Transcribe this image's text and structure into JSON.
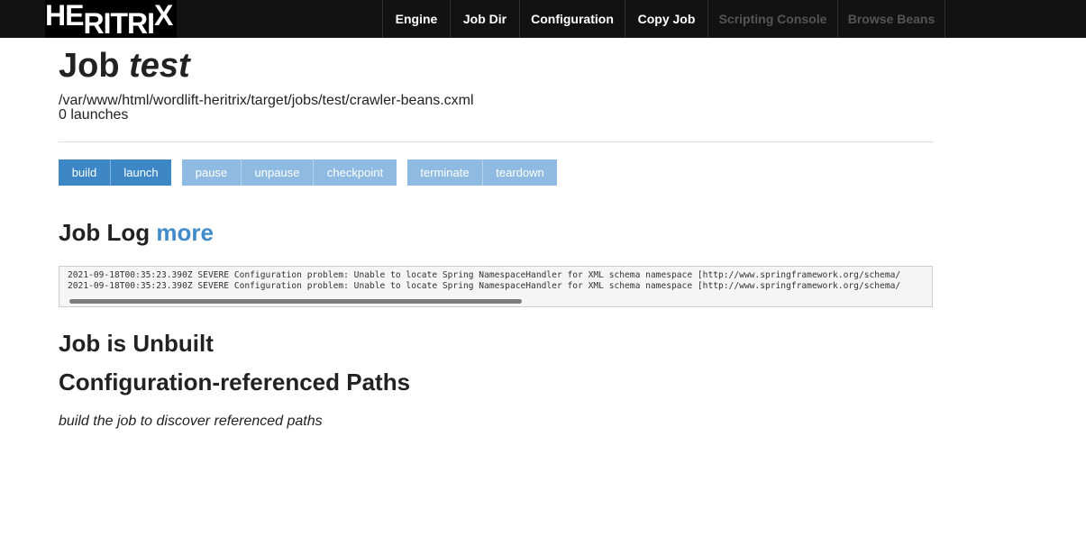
{
  "app": {
    "logo_parts": [
      "HE",
      "R",
      "I",
      "T",
      "R",
      "I",
      "X"
    ]
  },
  "nav": {
    "items": [
      {
        "label": "Engine",
        "enabled": true
      },
      {
        "label": "Job Dir",
        "enabled": true
      },
      {
        "label": "Configuration",
        "enabled": true
      },
      {
        "label": "Copy Job",
        "enabled": true
      },
      {
        "label": "Scripting Console",
        "enabled": false
      },
      {
        "label": "Browse Beans",
        "enabled": false
      }
    ]
  },
  "job": {
    "title_prefix": "Job",
    "name": "test",
    "config_path": "/var/www/html/wordlift-heritrix/target/jobs/test/crawler-beans.cxml",
    "launches": "0 launches"
  },
  "actions": {
    "build": "build",
    "launch": "launch",
    "pause": "pause",
    "unpause": "unpause",
    "checkpoint": "checkpoint",
    "terminate": "terminate",
    "teardown": "teardown"
  },
  "log": {
    "title": "Job Log",
    "more_link": "more",
    "lines": [
      "2021-09-18T00:35:23.390Z SEVERE Configuration problem: Unable to locate Spring NamespaceHandler for XML schema namespace [http://www.springframework.org/schema/",
      "2021-09-18T00:35:23.390Z SEVERE Configuration problem: Unable to locate Spring NamespaceHandler for XML schema namespace [http://www.springframework.org/schema/"
    ]
  },
  "status": {
    "unbuilt_title": "Job is Unbuilt",
    "paths_title": "Configuration-referenced Paths",
    "paths_hint": "build the job to discover referenced paths"
  },
  "colors": {
    "topbar": "#121212",
    "primary_button": "#3d87c6",
    "disabled_button": "#8fbbe2",
    "link": "#428bca"
  }
}
